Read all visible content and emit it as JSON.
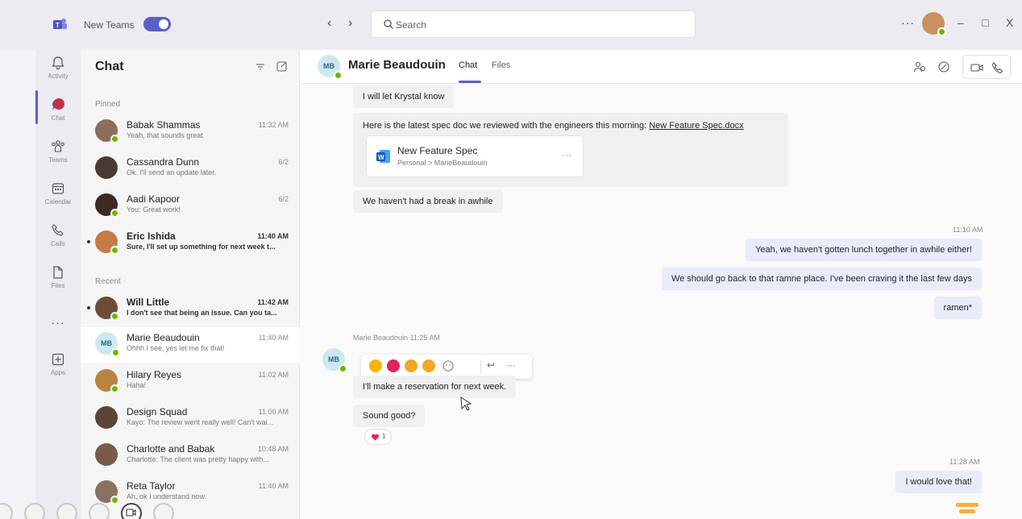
{
  "titlebar": {
    "new_teams_label": "New Teams",
    "toggle_on": true,
    "search_placeholder": "Search",
    "more": "···",
    "minimize": "–",
    "maximize": "□",
    "close": "X",
    "back": "‹",
    "forward": "›"
  },
  "rail": {
    "items": [
      {
        "label": "Activity",
        "icon": "bell-icon"
      },
      {
        "label": "Chat",
        "icon": "chat-icon"
      },
      {
        "label": "Teams",
        "icon": "teams-icon"
      },
      {
        "label": "Calendar",
        "icon": "calendar-icon"
      },
      {
        "label": "Calls",
        "icon": "phone-icon"
      },
      {
        "label": "Files",
        "icon": "file-icon"
      },
      {
        "label": "Apps",
        "icon": "apps-icon"
      }
    ],
    "more": "···"
  },
  "chatlist": {
    "title": "Chat",
    "pinned_label": "Pinned",
    "recent_label": "Recent",
    "pinned": [
      {
        "name": "Babak Shammas",
        "preview": "Yeah, that sounds great",
        "time": "11:32 AM",
        "unread": false
      },
      {
        "name": "Cassandra Dunn",
        "preview": "Ok. I'll send an update later.",
        "time": "6/2",
        "unread": false
      },
      {
        "name": "Aadi Kapoor",
        "preview": "You: Great work!",
        "time": "6/2",
        "unread": false
      },
      {
        "name": "Eric Ishida",
        "preview": "Sure, I'll set up something for next week t...",
        "time": "11:40 AM",
        "unread": true
      }
    ],
    "recent": [
      {
        "name": "Will Little",
        "preview": "I don't see that being an issue. Can you ta...",
        "time": "11:42 AM",
        "unread": true
      },
      {
        "name": "Marie Beaudouin",
        "initials": "MB",
        "preview": "Ohhh I see, yes let me fix that!",
        "time": "11:40 AM",
        "unread": false,
        "selected": true
      },
      {
        "name": "Hilary Reyes",
        "preview": "Haha!",
        "time": "11:02 AM",
        "unread": false
      },
      {
        "name": "Design Squad",
        "preview": "Kayo: The review went really well! Can't wai...",
        "time": "11:00 AM",
        "unread": false
      },
      {
        "name": "Charlotte and Babak",
        "preview": "Charlotte: The client was pretty happy with...",
        "time": "10:48 AM",
        "unread": false
      },
      {
        "name": "Reta Taylor",
        "preview": "Ah, ok I understand now.",
        "time": "11:40 AM",
        "unread": false
      }
    ]
  },
  "conversation": {
    "name": "Marie Beaudouin",
    "initials": "MB",
    "tabs": [
      "Chat",
      "Files"
    ],
    "messages": {
      "m1": "I will let Krystal know",
      "m2_prefix": "Here is the latest spec doc we reviewed with the engineers this morning: ",
      "m2_link": "New Feature Spec.docx",
      "file_name": "New Feature Spec",
      "file_path": "Personal > MarieBeaudouin",
      "file_more": "···",
      "m3": "We haven't had a break in awhile",
      "ts1": "11:10 AM",
      "o1": "Yeah, we haven't gotten lunch together in awhile either!",
      "o2": "We should go back to that ramne place. I've been craving it the last few days",
      "o3": "ramen*",
      "sender_line": "Marie Beaudouin   11:25 AM",
      "m4": "I'll make a reservation for next week.",
      "m5": "Sound good?",
      "reaction_count": "1",
      "ts2": "11:28 AM",
      "o4": "I would love that!"
    },
    "reply_icon": "↩",
    "reaction_more": "···"
  },
  "colors": {
    "accent": "#5b5fc7",
    "presence": "#6bb700",
    "badge": "#c4314b"
  }
}
